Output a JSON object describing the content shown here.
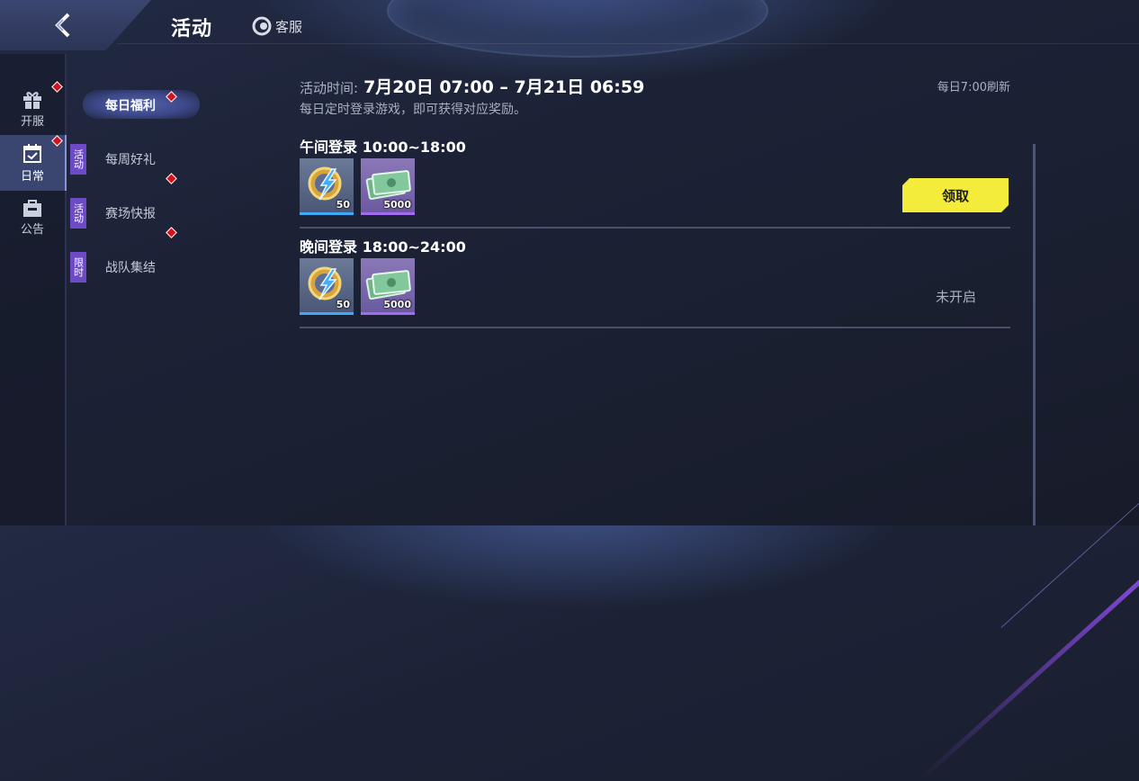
{
  "header": {
    "title": "活动",
    "customer_service": "客服"
  },
  "rail": {
    "items": [
      {
        "label": "开服",
        "icon": "gift-icon",
        "badge": true,
        "active": false
      },
      {
        "label": "日常",
        "icon": "calendar-check-icon",
        "badge": true,
        "active": true
      },
      {
        "label": "公告",
        "icon": "bag-icon",
        "badge": false,
        "active": false
      }
    ]
  },
  "subnav": {
    "items": [
      {
        "label": "每日福利",
        "tag": "",
        "badge": true,
        "active": true
      },
      {
        "label": "每周好礼",
        "tag": "活动",
        "badge": false,
        "active": false
      },
      {
        "label": "赛场快报",
        "tag": "活动",
        "badge": true,
        "active": false
      },
      {
        "label": "战队集结",
        "tag": "限时",
        "badge": true,
        "active": false
      }
    ]
  },
  "activity": {
    "time_label": "活动时间:",
    "time_value": "7月20日 07:00 – 7月21日 06:59",
    "refresh_note": "每日7:00刷新",
    "description": "每日定时登录游戏，即可获得对应奖励。"
  },
  "entries": [
    {
      "title": "午间登录 10:00~18:00",
      "rewards": [
        {
          "icon": "energy-coin-icon",
          "qty": "50"
        },
        {
          "icon": "cash-bundle-icon",
          "qty": "5000"
        }
      ],
      "action_label": "领取",
      "state": "claimable"
    },
    {
      "title": "晚间登录 18:00~24:00",
      "rewards": [
        {
          "icon": "energy-coin-icon",
          "qty": "50"
        },
        {
          "icon": "cash-bundle-icon",
          "qty": "5000"
        }
      ],
      "status_label": "未开启",
      "state": "locked"
    }
  ],
  "colors": {
    "accent_yellow": "#f3ec3a",
    "badge_red": "#d4141c",
    "tag_purple": "#6c4bc4"
  }
}
